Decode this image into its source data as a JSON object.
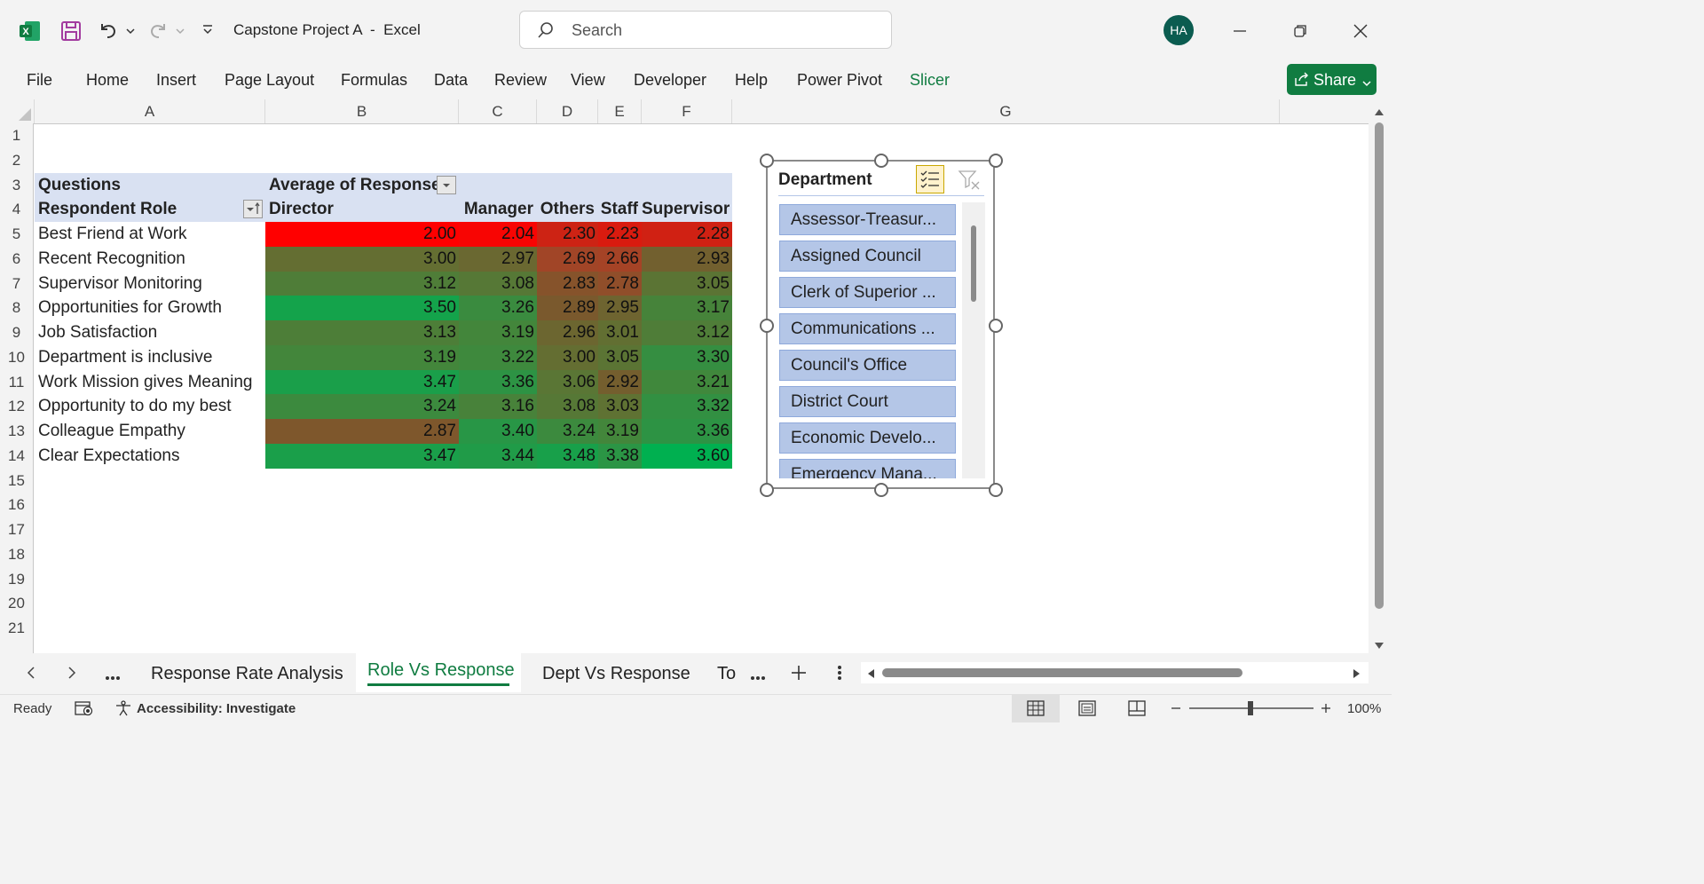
{
  "titlebar": {
    "title": "Capstone Project A  -  Excel",
    "search_placeholder": "Search",
    "user_initials": "HA"
  },
  "menu": {
    "items": [
      "File",
      "Home",
      "Insert",
      "Page Layout",
      "Formulas",
      "Data",
      "Review",
      "View",
      "Developer",
      "Help",
      "Power Pivot",
      "Slicer"
    ],
    "share_label": "Share",
    "active_color": "#107c41"
  },
  "sheet": {
    "columns": [
      "A",
      "B",
      "C",
      "D",
      "E",
      "F",
      "G"
    ],
    "rows": [
      "1",
      "2",
      "3",
      "4",
      "5",
      "6",
      "7",
      "8",
      "9",
      "10",
      "11",
      "12",
      "13",
      "14",
      "15",
      "16",
      "17",
      "18",
      "19",
      "20",
      "21"
    ],
    "pivot": {
      "row3_label": "Questions",
      "value_field": "Average of Response",
      "row4_label": "Respondent Role",
      "roles": [
        "Director",
        "Manager",
        "Others",
        "Staff",
        "Supervisor"
      ],
      "questions": [
        {
          "name": "Best Friend at Work",
          "values": [
            "2.00",
            "2.04",
            "2.30",
            "2.23",
            "2.28"
          ]
        },
        {
          "name": "Recent Recognition",
          "values": [
            "3.00",
            "2.97",
            "2.69",
            "2.66",
            "2.93"
          ]
        },
        {
          "name": "Supervisor Monitoring",
          "values": [
            "3.12",
            "3.08",
            "2.83",
            "2.78",
            "3.05"
          ]
        },
        {
          "name": "Opportunities for Growth",
          "values": [
            "3.50",
            "3.26",
            "2.89",
            "2.95",
            "3.17"
          ]
        },
        {
          "name": "Job Satisfaction",
          "values": [
            "3.13",
            "3.19",
            "2.96",
            "3.01",
            "3.12"
          ]
        },
        {
          "name": "Department is inclusive",
          "values": [
            "3.19",
            "3.22",
            "3.00",
            "3.05",
            "3.30"
          ]
        },
        {
          "name": "Work Mission gives Meaning",
          "values": [
            "3.47",
            "3.36",
            "3.06",
            "2.92",
            "3.21"
          ]
        },
        {
          "name": "Opportunity to do my best",
          "values": [
            "3.24",
            "3.16",
            "3.08",
            "3.03",
            "3.32"
          ]
        },
        {
          "name": "Colleague Empathy",
          "values": [
            "2.87",
            "3.40",
            "3.24",
            "3.19",
            "3.36"
          ]
        },
        {
          "name": "Clear Expectations",
          "values": [
            "3.47",
            "3.44",
            "3.48",
            "3.38",
            "3.60"
          ]
        }
      ],
      "header_fill": "#d9e1f2"
    }
  },
  "slicer": {
    "title": "Department",
    "items": [
      "Assessor-Treasur...",
      "Assigned Council",
      "Clerk of Superior ...",
      "Communications ...",
      "Council's Office",
      "District Court",
      "Economic Develo...",
      "Emergency Mana..."
    ]
  },
  "tabs": {
    "sheets": [
      "Response Rate Analysis",
      "Role Vs Response",
      "Dept Vs Response",
      "To"
    ],
    "active": "Role Vs Response"
  },
  "status": {
    "ready": "Ready",
    "accessibility": "Accessibility: Investigate",
    "zoom": "100%"
  }
}
